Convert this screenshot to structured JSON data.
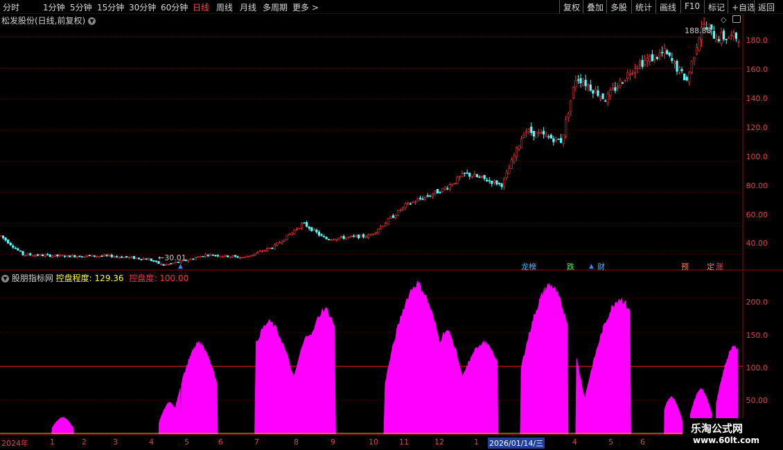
{
  "toolbar": {
    "periods": [
      "分时",
      "1分钟",
      "5分钟",
      "15分钟",
      "30分钟",
      "60分钟",
      "日线",
      "周线",
      "月线",
      "多周期",
      "更多"
    ],
    "active_period": "日线",
    "right_buttons": [
      "复权",
      "叠加",
      "多股",
      "统计",
      "画线",
      "F10",
      "标记",
      "+自选",
      "返回"
    ]
  },
  "main_chart": {
    "title": "松发股份(日线,前复权)",
    "high_label": "188.88",
    "low_label": "30.01",
    "y_ticks": [
      "180.0",
      "160.0",
      "140.0",
      "120.0",
      "100.0",
      "80.00",
      "60.00",
      "40.00"
    ],
    "events": [
      {
        "text": "龙榜",
        "color": "#40c0ff"
      },
      {
        "text": "跌",
        "color": "#40ff40"
      },
      {
        "text": "财",
        "color": "#40c0ff"
      },
      {
        "text": "预",
        "color": "#ff8040"
      },
      {
        "text": "定",
        "color": "#ff8040"
      },
      {
        "text": "涨",
        "color": "#ff4040"
      }
    ]
  },
  "sub_chart": {
    "indicator_name": "股朋指标网",
    "series1_label": "控盘程度:",
    "series1_value": "129.36",
    "series2_label": "控盘度:",
    "series2_value": "100.00",
    "y_ticks": [
      "200.0",
      "150.0",
      "100.0",
      "50.00"
    ]
  },
  "x_axis": {
    "labels": [
      "2024年",
      "1",
      "2",
      "3",
      "4",
      "5",
      "6",
      "7",
      "8",
      "9",
      "10",
      "11",
      "12",
      "1",
      "2026/01/14/三",
      "4",
      "5",
      "6"
    ],
    "selected": "2026/01/14/三"
  },
  "watermark": {
    "title": "乐淘公式网",
    "url": "www.60lt.com"
  },
  "chart_data": [
    {
      "type": "candlestick",
      "title": "松发股份(日线,前复权)",
      "ylim": [
        30,
        195
      ],
      "approx_close_path": [
        [
          0,
          52
        ],
        [
          0.03,
          40
        ],
        [
          0.08,
          39
        ],
        [
          0.15,
          39
        ],
        [
          0.2,
          37
        ],
        [
          0.22,
          33
        ],
        [
          0.25,
          36
        ],
        [
          0.28,
          40
        ],
        [
          0.33,
          38
        ],
        [
          0.37,
          45
        ],
        [
          0.41,
          60
        ],
        [
          0.44,
          50
        ],
        [
          0.5,
          52
        ],
        [
          0.55,
          72
        ],
        [
          0.6,
          82
        ],
        [
          0.63,
          92
        ],
        [
          0.68,
          85
        ],
        [
          0.71,
          120
        ],
        [
          0.76,
          113
        ],
        [
          0.78,
          155
        ],
        [
          0.82,
          140
        ],
        [
          0.86,
          162
        ],
        [
          0.9,
          170
        ],
        [
          0.93,
          152
        ],
        [
          0.95,
          188
        ],
        [
          0.97,
          180
        ]
      ],
      "annotations": {
        "max": 188.88,
        "min": 30.01
      }
    },
    {
      "type": "area",
      "series": [
        {
          "name": "控盘程度",
          "color": "#ff00ff"
        }
      ],
      "reference_line": {
        "name": "控盘度",
        "value": 100.0,
        "color": "#ff2020"
      },
      "ylim": [
        0,
        240
      ],
      "peaks": [
        {
          "x": 0.085,
          "y": 25
        },
        {
          "x": 0.23,
          "y": 47
        },
        {
          "x": 0.27,
          "y": 135
        },
        {
          "x": 0.365,
          "y": 165
        },
        {
          "x": 0.42,
          "y": 150
        },
        {
          "x": 0.44,
          "y": 185
        },
        {
          "x": 0.565,
          "y": 222
        },
        {
          "x": 0.605,
          "y": 153
        },
        {
          "x": 0.655,
          "y": 135
        },
        {
          "x": 0.745,
          "y": 220
        },
        {
          "x": 0.84,
          "y": 200
        },
        {
          "x": 0.91,
          "y": 55
        },
        {
          "x": 0.95,
          "y": 67
        },
        {
          "x": 0.995,
          "y": 129
        }
      ]
    }
  ]
}
